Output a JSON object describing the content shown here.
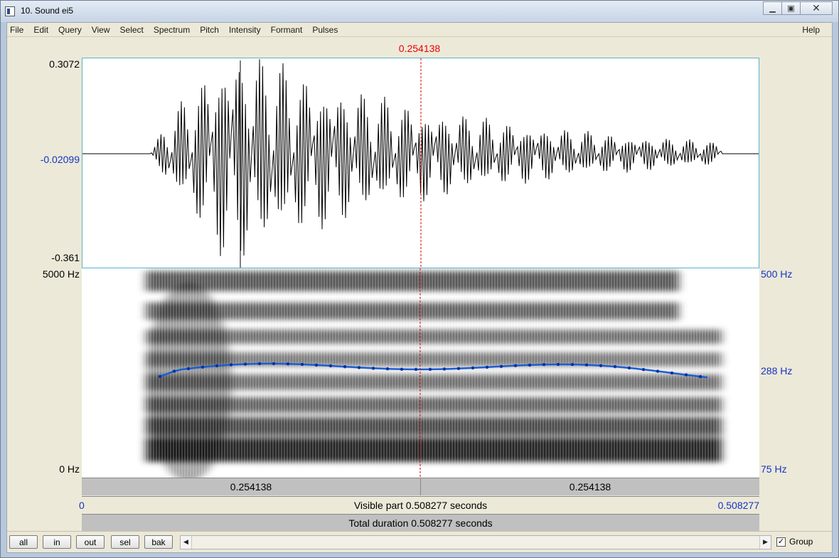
{
  "window": {
    "title": "10. Sound ei5"
  },
  "menu": {
    "items": [
      "File",
      "Edit",
      "Query",
      "View",
      "Select",
      "Spectrum",
      "Pitch",
      "Intensity",
      "Formant",
      "Pulses"
    ],
    "help": "Help"
  },
  "cursor": {
    "time": "0.254138"
  },
  "waveform": {
    "y_max": "0.3072",
    "y_mid": "-0.02099",
    "y_min": "-0.361"
  },
  "spectrogram": {
    "freq_max": "5000 Hz",
    "freq_min": "0 Hz",
    "pitch_max": "500 Hz",
    "pitch_mid": "288 Hz",
    "pitch_min": "75 Hz"
  },
  "rulers": {
    "left_segment": "0.254138",
    "right_segment": "0.254138",
    "visible_start": "0",
    "visible_label": "Visible part 0.508277 seconds",
    "visible_end": "0.508277",
    "total_label": "Total duration 0.508277 seconds"
  },
  "buttons": {
    "all": "all",
    "in": "in",
    "out": "out",
    "sel": "sel",
    "bak": "bak"
  },
  "group": {
    "label": "Group",
    "checked": true,
    "check_mark": "✓"
  },
  "colors": {
    "cursor": "#e00000",
    "pitch_curve": "#1a5fd0",
    "axis_blue": "#1533c4"
  }
}
